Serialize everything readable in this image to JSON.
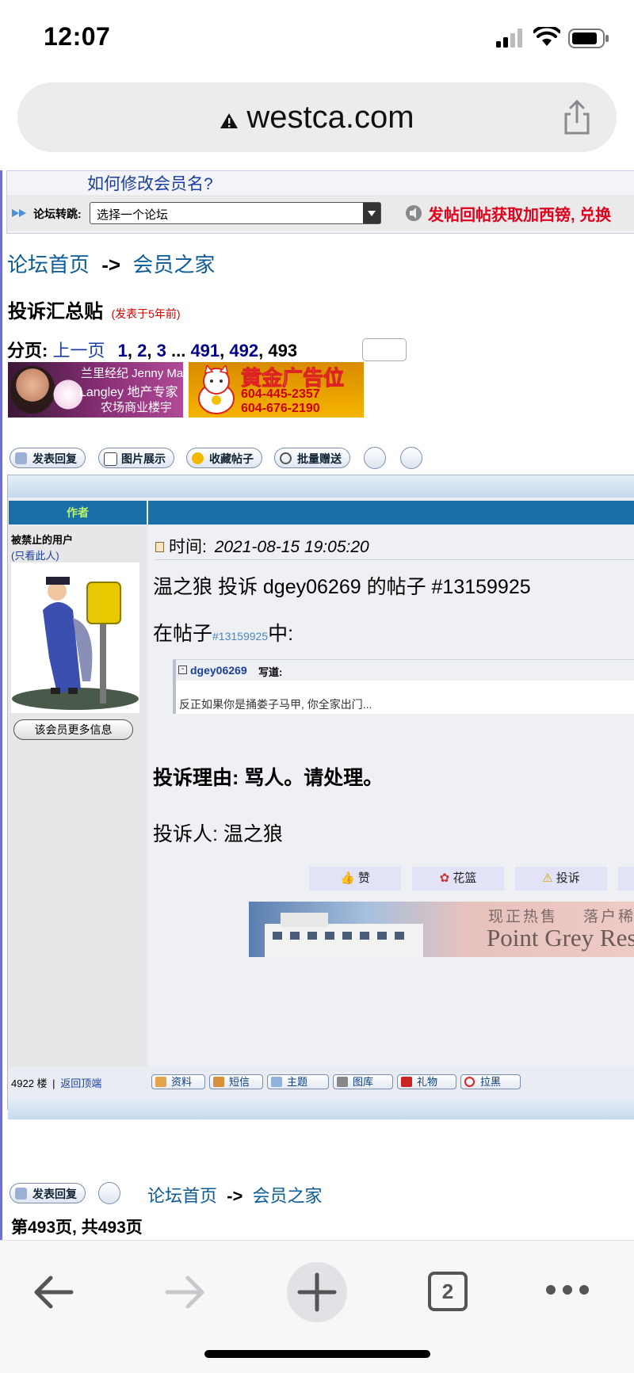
{
  "status": {
    "time": "12:07"
  },
  "browser": {
    "url": "westca.com",
    "tab_count": "2"
  },
  "forum_jump": {
    "prev_link": "如何修改会员名?",
    "label": "论坛转跳:",
    "select_value": "选择一个论坛",
    "promo": "发帖回帖获取加西镑, 兑换"
  },
  "breadcrumb": {
    "home": "论坛首页",
    "sep": "->",
    "section": "会员之家"
  },
  "thread": {
    "title": "投诉汇总贴",
    "posted": "(发表于5年前)"
  },
  "pagination": {
    "label": "分页:",
    "prev": "上一页",
    "p1": "1",
    "p2": "2",
    "p3": "3",
    "ellipsis": "...",
    "p491": "491",
    "p492": "492",
    "p493": "493",
    "comma": ","
  },
  "ads": {
    "ad1_line1": "兰里经纪 Jenny Ma",
    "ad1_line2": "Langley 地产专家",
    "ad1_line3": "农场商业楼宇",
    "ad2_line1": "黄金广告位",
    "ad2_line2": "604-445-2357",
    "ad2_line3": "604-676-2190"
  },
  "actions": {
    "reply": "发表回复",
    "images": "图片展示",
    "favorite": "收藏帖子",
    "gift": "批量赠送"
  },
  "table": {
    "author_header": "作者"
  },
  "author": {
    "status": "被禁止的用户",
    "only_this": "(只看此人)",
    "more_info": "该会员更多信息"
  },
  "post": {
    "time_label": "时间:",
    "time_value": "2021-08-15 19:05:20",
    "headline": "温之狼 投诉 dgey06269 的帖子 #13159925",
    "in_post_prefix": "在帖子",
    "in_post_id": "#13159925",
    "in_post_suffix": "中:",
    "quote_user": "dgey06269",
    "quote_wrote": "写道:",
    "quote_text": "反正如果你是捅娄子马甲, 你全家出门...",
    "reason": "投诉理由: 骂人。请处理。",
    "complainant": "投诉人: 温之狼",
    "like": "赞",
    "flower": "花篮",
    "report": "投诉",
    "banner_text1": "现正热售",
    "banner_text2": "落户稀",
    "banner_text3": "Point Grey Res"
  },
  "footer_row": {
    "floor": "4922 楼",
    "divider": "|",
    "top_link": "返回顶端",
    "profile": "资料",
    "message": "短信",
    "topics": "主题",
    "gallery": "图库",
    "gifts": "礼物",
    "block": "拉黑"
  },
  "page_info": {
    "text_a": "第",
    "cur": "493",
    "text_b": "页, 共",
    "total": "493",
    "text_c": "页"
  },
  "colors": {
    "link": "#0b5c99",
    "navy": "#00008b",
    "header_bar": "#1b6fa8",
    "promo_red": "#e0001b",
    "posted_red": "#d40000"
  }
}
